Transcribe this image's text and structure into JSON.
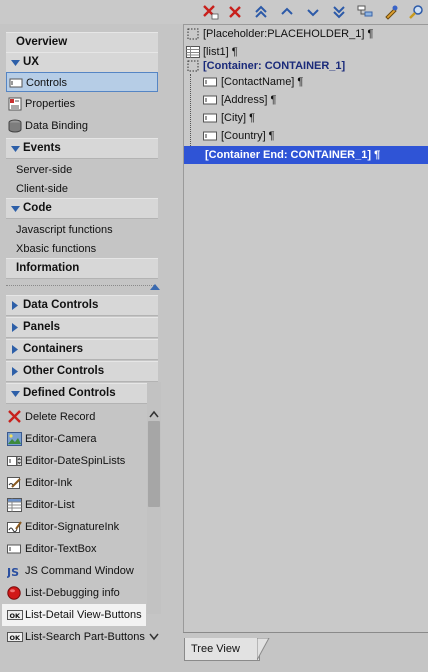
{
  "toolbar": {
    "icons": [
      "delete-red-x-icon",
      "delete-x-icon",
      "move-top-icon",
      "move-up-icon",
      "move-down-icon",
      "move-bottom-icon",
      "tree-options-icon",
      "edit-pencil-icon",
      "find-icon"
    ]
  },
  "nav": {
    "overview": "Overview",
    "ux": "UX",
    "ux_items": [
      "Controls",
      "Properties",
      "Data Binding"
    ],
    "events": "Events",
    "events_items": [
      "Server-side",
      "Client-side"
    ],
    "code": "Code",
    "code_items": [
      "Javascript functions",
      "Xbasic functions"
    ],
    "information": "Information"
  },
  "categories": {
    "data_controls": "Data Controls",
    "panels": "Panels",
    "containers": "Containers",
    "other_controls": "Other Controls",
    "defined_controls": "Defined Controls"
  },
  "defined_controls": [
    "Delete Record",
    "Editor-Camera",
    "Editor-DateSpinLists",
    "Editor-Ink",
    "Editor-List",
    "Editor-SignatureInk",
    "Editor-TextBox",
    "JS Command Window",
    "List-Debugging info",
    "List-Detail View-Buttons",
    "List-Search Part-Buttons"
  ],
  "tree": {
    "rows": [
      "[Placeholder:PLACEHOLDER_1] ¶",
      "[list1] ¶",
      "[Container: CONTAINER_1]",
      "[ContactName] ¶",
      "[Address] ¶",
      "[City] ¶",
      "[Country] ¶",
      "[Container End: CONTAINER_1] ¶"
    ],
    "tab_label": "Tree View"
  },
  "colors": {
    "selection_blue": "#2f54d6",
    "container_text": "#1a2a7a",
    "nav_selected_bg": "#b6cde6"
  }
}
